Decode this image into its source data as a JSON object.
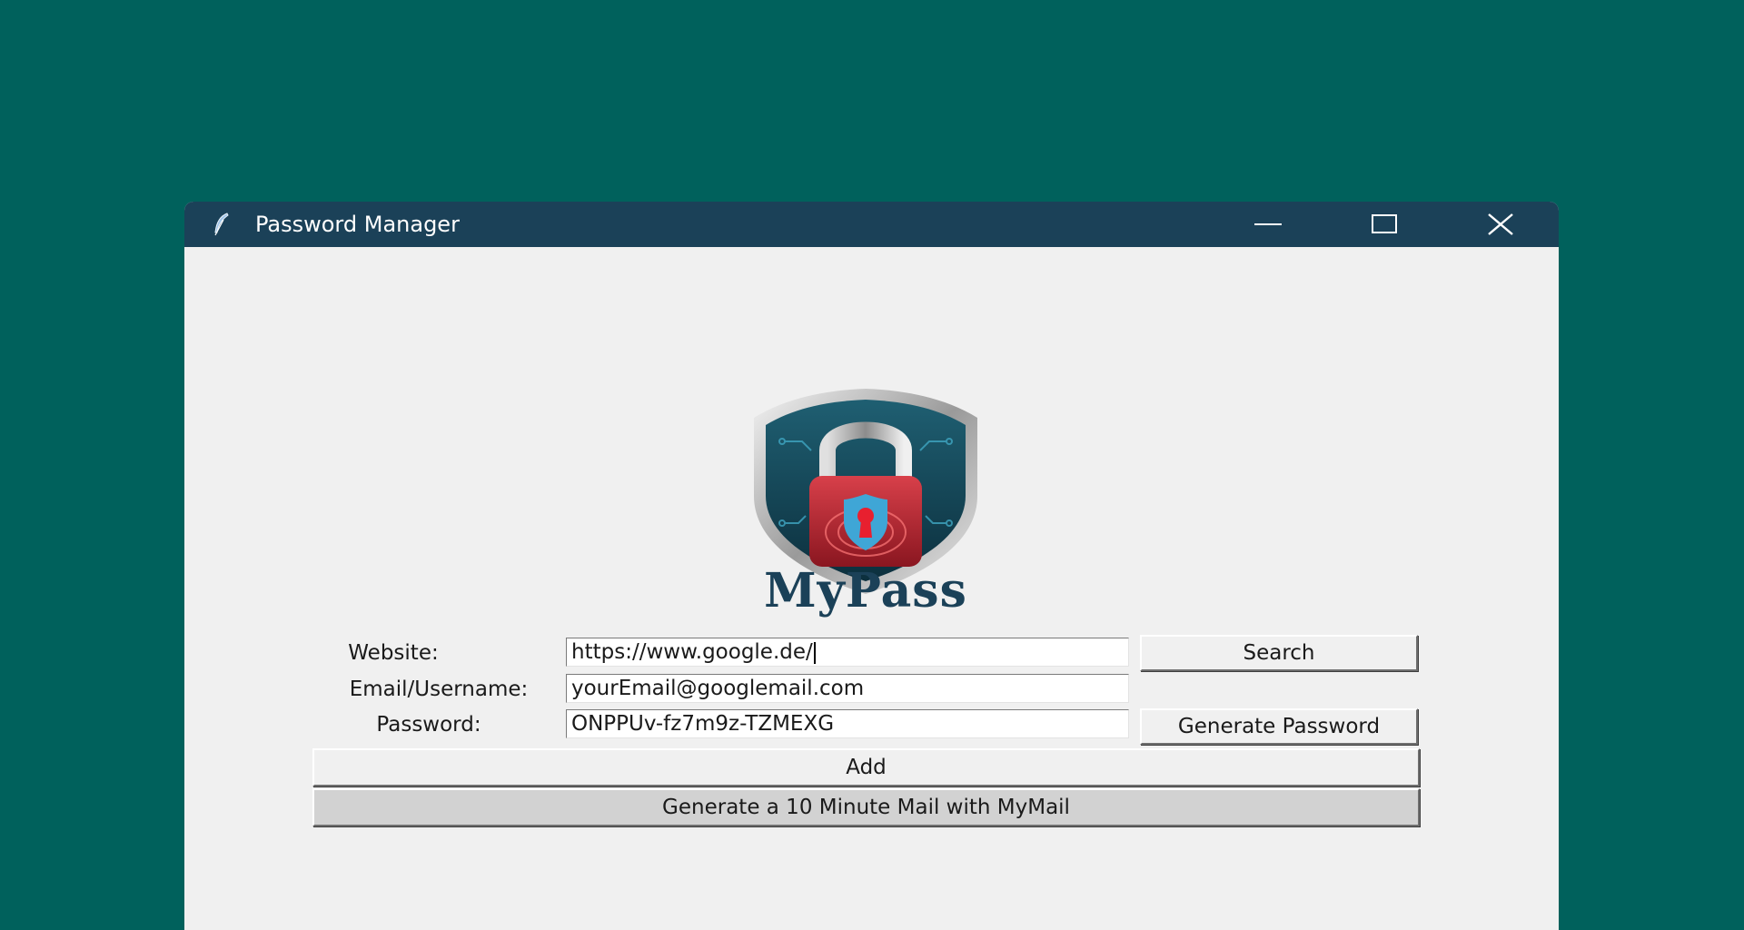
{
  "window": {
    "title": "Password Manager",
    "controls": {
      "minimize": "minimize-icon",
      "maximize": "maximize-icon",
      "close": "close-icon"
    }
  },
  "app": {
    "brand": "MyPass",
    "logo": "padlock-shield-logo"
  },
  "form": {
    "website": {
      "label": "Website:",
      "value": "https://www.google.de/"
    },
    "email": {
      "label": "Email/Username:",
      "value": "yourEmail@googlemail.com"
    },
    "password": {
      "label": "Password:",
      "value": "ONPPUv-fz7m9z-TZMEXG"
    }
  },
  "buttons": {
    "search": "Search",
    "generate_password": "Generate Password",
    "add": "Add",
    "mymail": "Generate a 10 Minute Mail with MyMail"
  },
  "colors": {
    "desktop": "#00615c",
    "titlebar": "#1b4158",
    "window_bg": "#f0f0f0",
    "brand_text": "#1b4158"
  }
}
